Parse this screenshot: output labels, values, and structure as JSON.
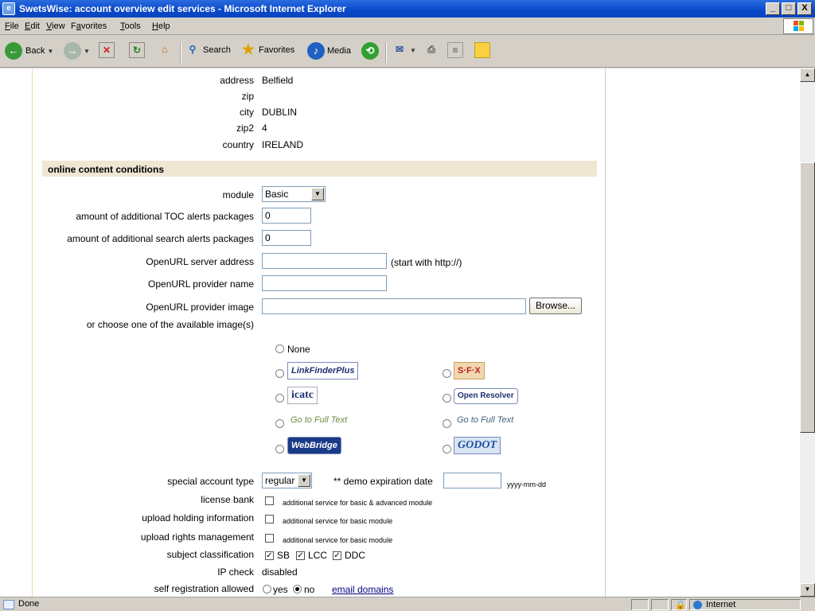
{
  "window": {
    "title": "SwetsWise: account overview edit services - Microsoft Internet Explorer",
    "minimize": "_",
    "maximize": "□",
    "close": "X"
  },
  "menu": {
    "file": {
      "u": "F",
      "rest": "ile"
    },
    "edit": {
      "u": "E",
      "rest": "dit"
    },
    "view": {
      "u": "V",
      "rest": "iew"
    },
    "favorites": {
      "pre": "F",
      "u": "a",
      "rest": "vorites"
    },
    "tools": {
      "u": "T",
      "rest": "ools"
    },
    "help": {
      "u": "H",
      "rest": "elp"
    }
  },
  "toolbar": {
    "back": "Back",
    "search": "Search",
    "favorites": "Favorites",
    "media": "Media"
  },
  "address_block": {
    "address_label": "address",
    "address_value": "Belfield",
    "zip_label": "zip",
    "zip_value": "",
    "city_label": "city",
    "city_value": "DUBLIN",
    "zip2_label": "zip2",
    "zip2_value": "4",
    "country_label": "country",
    "country_value": "IRELAND"
  },
  "section": {
    "title": "online content conditions"
  },
  "form": {
    "module_label": "module",
    "module_value": "Basic",
    "toc_label": "amount of additional TOC alerts packages",
    "toc_value": "0",
    "search_alerts_label": "amount of additional search alerts packages",
    "search_alerts_value": "0",
    "openurl_server_label": "OpenURL server address",
    "openurl_server_value": "",
    "openurl_server_hint": "(start with http://)",
    "openurl_provider_label": "OpenURL provider name",
    "openurl_provider_value": "",
    "openurl_image_label": "OpenURL provider image",
    "openurl_image_value": "",
    "browse_label": "Browse...",
    "choose_image_label": "or choose one of the available image(s)",
    "none_label": "None",
    "special_account_label": "special account type",
    "special_account_value": "regular",
    "demo_expiration_label": "** demo expiration date",
    "demo_expiration_value": "",
    "demo_expiration_hint": "yyyy-mm-dd",
    "license_bank_label": "license bank",
    "license_bank_note": "additional service for basic & advanced module",
    "upload_holding_label": "upload holding information",
    "upload_holding_note": "additional service for basic module",
    "upload_rights_label": "upload rights management",
    "upload_rights_note": "additional service for basic module",
    "subject_class_label": "subject classification",
    "sb_label": "SB",
    "lcc_label": "LCC",
    "ddc_label": "DDC",
    "ip_check_label": "IP check",
    "ip_check_value": "disabled",
    "self_reg_label": "self registration allowed",
    "yes_label": "yes",
    "no_label": "no",
    "email_domains_link": "email domains"
  },
  "images": {
    "linkfinder": "LinkFinderPlus",
    "sfx": "S·F·X",
    "icate": "icatc",
    "openresolver": "Open Resolver",
    "gofulltext1": "Go to Full Text",
    "gofulltext2": "Go to Full Text",
    "webbridge": "WebBridge",
    "godot": "GODOT"
  },
  "status": {
    "text": "Done",
    "zone": "Internet"
  },
  "colors": {
    "titlebar": "#0a48c8",
    "section_bg": "#efe6d4",
    "link": "#000080"
  }
}
